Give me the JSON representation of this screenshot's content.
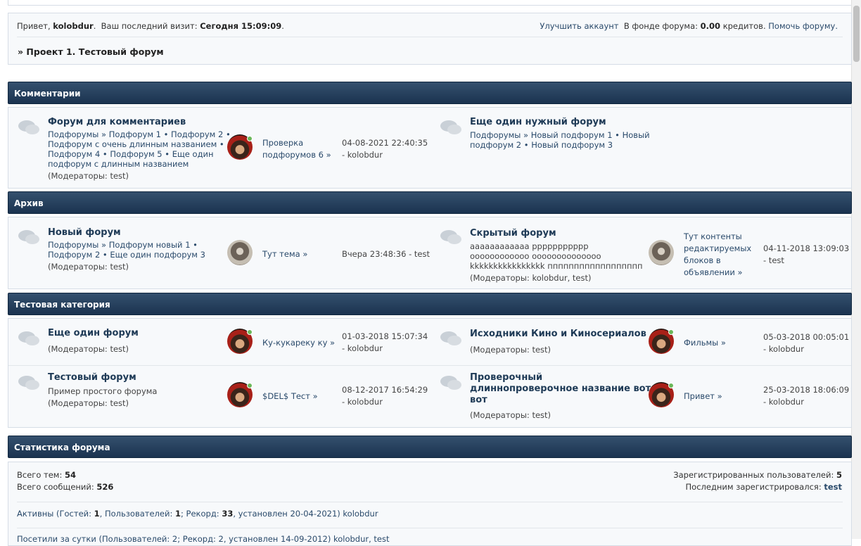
{
  "welcome": {
    "greeting": "Привет,",
    "username": "kolobdur",
    "last_visit_label": "Ваш последний визит:",
    "last_visit_value": "Сегодня 15:09:09",
    "upgrade": "Улучшить аккаунт",
    "fund_label": "В фонде форума:",
    "fund_value": "0.00",
    "credits": "кредитов.",
    "help": "Помочь форуму.",
    "breadcrumb": "» Проект 1. Тестовый форум"
  },
  "categories": [
    {
      "title": "Комментарии",
      "forums": [
        {
          "name": "Форум для комментариев",
          "subs_line1": "Подфорумы » Подфорум 1 • Подфорум 2 •",
          "subs_line2": "Подфорум с очень длинным названием •",
          "subs_line3": "Подфорум 4 • Подфорум 5 • Еще один",
          "subs_line4": "подфорум с длинным названием",
          "mods": "(Модераторы: test)",
          "topic_line1": "Проверка",
          "topic_line2": "подфорумов 6 »",
          "date": "04-08-2021 22:40:35",
          "author": "- kolobdur"
        },
        {
          "name": "Еще один нужный форум",
          "subs_line1": "Подфорумы » Новый подфорум 1 • Новый",
          "subs_line2": "подфорум 2 • Новый подфорум 3"
        }
      ]
    },
    {
      "title": "Архив",
      "forums": [
        {
          "name": "Новый форум",
          "subs_line1": "Подфорумы » Подфорум новый 1 •",
          "subs_line2": "Подфорум 2 • Еще один подфорум 3",
          "mods": "(Модераторы: test)",
          "topic": "Тут тема »",
          "date": "Вчера 23:48:36 - test"
        },
        {
          "name": "Скрытый форум",
          "desc_line1": "аааааааааааа ррррррррррр",
          "desc_line2": "оооооооооооо оооооооооооооо",
          "desc_line3": "kkkkkkkkkkkkkkkk пппппппппппппппппп",
          "mods": "(Модераторы: kolobdur, test)",
          "topic_line1": "Тут контенты",
          "topic_line2": "редактируемых",
          "topic_line3": "блоков в",
          "topic_line4": "объявлении »",
          "date": "04-11-2018 13:09:03",
          "author": "- test"
        }
      ]
    },
    {
      "title": "Тестовая категория",
      "forums": [
        {
          "name": "Еще один форум",
          "mods": "(Модераторы: test)",
          "topic": "Ку-кукареку ку »",
          "date": "01-03-2018 15:07:34",
          "author": "- kolobdur"
        },
        {
          "name": "Исходники Кино и Киносериалов",
          "mods": "(Модераторы: test)",
          "topic": "Фильмы »",
          "date": "05-03-2018 00:05:01",
          "author": "- kolobdur"
        },
        {
          "name": "Тестовый форум",
          "desc": "Пример простого форума",
          "mods": "(Модераторы: test)",
          "topic": "$DEL$ Тест »",
          "date": "08-12-2017 16:54:29",
          "author": "- kolobdur"
        },
        {
          "name_line1": "Проверочный",
          "name_line2": "длиннопроверочное название вот",
          "name_line3": "вот",
          "mods": "(Модераторы: test)",
          "topic": "Привет »",
          "date": "25-03-2018 18:06:09",
          "author": "- kolobdur"
        }
      ]
    }
  ],
  "stats": {
    "title": "Статистика форума",
    "topics_label": "Всего тем:",
    "topics": "54",
    "posts_label": "Всего сообщений:",
    "posts": "526",
    "registered_label": "Зарегистрированных пользователей:",
    "registered": "5",
    "last_reg_label": "Последним зарегистрировался:",
    "last_reg": "test",
    "active_prefix": "Активны (Гостей:",
    "guests": "1",
    "users_label": ", Пользователей:",
    "users": "1",
    "record_label": "; Рекорд:",
    "record": "33",
    "record_suffix": ", установлен 20-04-2021) kolobdur",
    "daily": "Посетили за сутки (Пользователей: 2; Рекорд: 2, установлен 14-09-2012) kolobdur, test"
  }
}
